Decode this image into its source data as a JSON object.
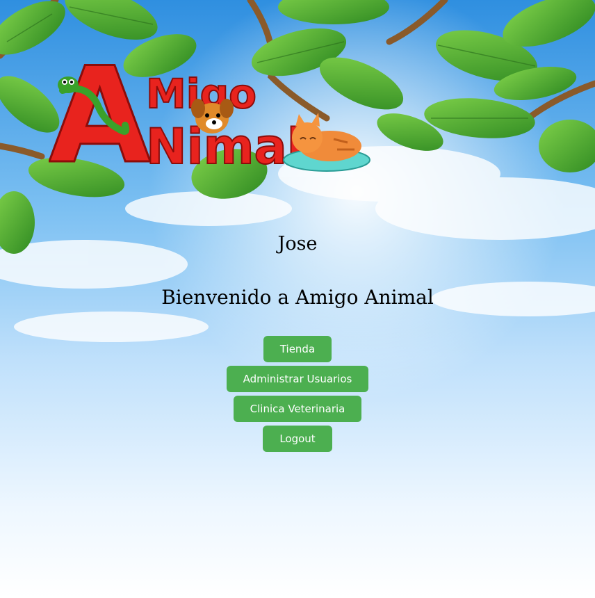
{
  "logo": {
    "line1": "Migo",
    "line2": "Nimal",
    "initial": "A"
  },
  "user": {
    "name": "Jose"
  },
  "welcome": "Bienvenido a Amigo Animal",
  "menu": [
    {
      "label": "Tienda"
    },
    {
      "label": "Administrar Usuarios"
    },
    {
      "label": "Clinica Veterinaria"
    },
    {
      "label": "Logout"
    }
  ],
  "colors": {
    "button": "#4caf50",
    "sky_top": "#3a9be8",
    "logo_red": "#e8231e"
  }
}
